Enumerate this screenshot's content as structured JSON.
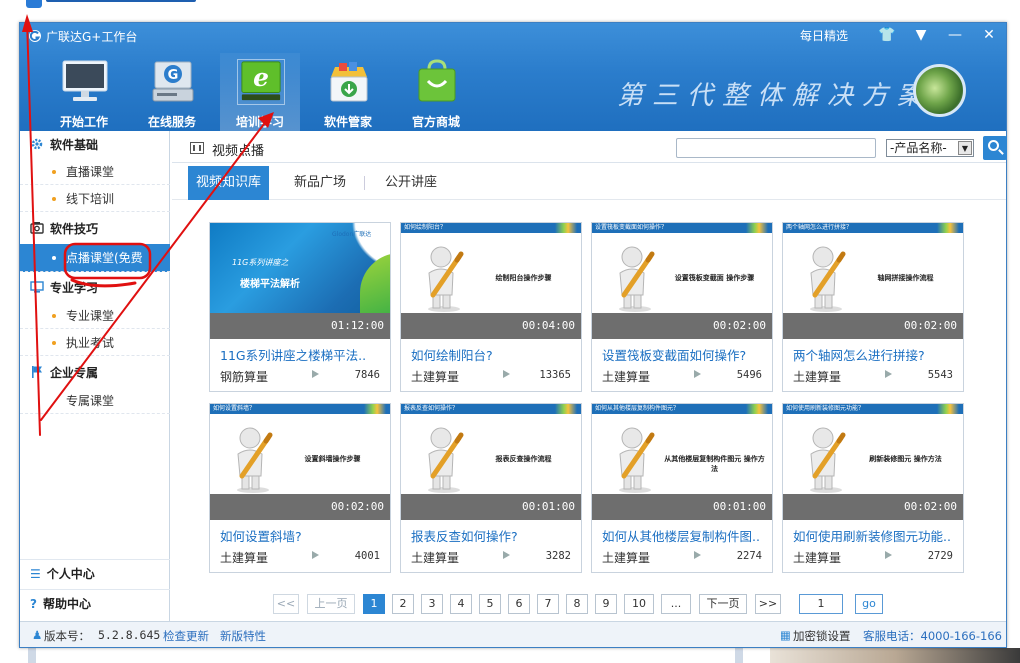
{
  "app": {
    "title": "广联达G+工作台"
  },
  "window_controls": {
    "daily": "每日精选",
    "shirt": "👕",
    "dropdown": "▼",
    "minimize": "—",
    "close": "✕"
  },
  "nav": [
    {
      "label": "开始工作",
      "icon": "monitor-icon"
    },
    {
      "label": "在线服务",
      "icon": "server-icon"
    },
    {
      "label": "培训学习",
      "icon": "ie-browser-icon"
    },
    {
      "label": "软件管家",
      "icon": "software-box-icon"
    },
    {
      "label": "官方商城",
      "icon": "shopping-bag-icon"
    }
  ],
  "slogan": "第三代整体解决方案",
  "sidebar": {
    "cat1": "软件基础",
    "items1": [
      "直播课堂",
      "线下培训"
    ],
    "cat2": "软件技巧",
    "items2": [
      "点播课堂(免费"
    ],
    "cat3": "专业学习",
    "items3": [
      "专业课堂",
      "执业考试"
    ],
    "cat4": "企业专属",
    "items4": [
      "专属课堂"
    ],
    "personal": "个人中心",
    "help": "帮助中心"
  },
  "header": {
    "title": "视频点播",
    "select_value": "-产品名称-"
  },
  "tabs": [
    "视频知识库",
    "新品广场",
    "公开讲座"
  ],
  "cards": [
    {
      "title": "11G系列讲座之楼梯平法..",
      "category": "钢筋算量",
      "views": "7846",
      "duration": "01:12:00",
      "thumb_top": "",
      "thumb_desc": "",
      "t1": "11G系列讲座之",
      "t2": "楼梯平法解析",
      "t3": "Glodon广联达"
    },
    {
      "title": "如何绘制阳台?",
      "category": "土建算量",
      "views": "13365",
      "duration": "00:04:00",
      "thumb_top": "如何绘制阳台？",
      "thumb_desc": "绘制阳台操作步骤"
    },
    {
      "title": "设置筏板变截面如何操作?",
      "category": "土建算量",
      "views": "5496",
      "duration": "00:02:00",
      "thumb_top": "设置筏板变截面如何操作？",
      "thumb_desc": "设置筏板变截面 操作步骤"
    },
    {
      "title": "两个轴网怎么进行拼接?",
      "category": "土建算量",
      "views": "5543",
      "duration": "00:02:00",
      "thumb_top": "两个轴网怎么进行拼接？",
      "thumb_desc": "轴网拼接操作流程"
    },
    {
      "title": "如何设置斜墙?",
      "category": "土建算量",
      "views": "4001",
      "duration": "00:02:00",
      "thumb_top": "如何设置斜墙？",
      "thumb_desc": "设置斜墙操作步骤"
    },
    {
      "title": "报表反查如何操作?",
      "category": "土建算量",
      "views": "3282",
      "duration": "00:01:00",
      "thumb_top": "报表反查如何操作？",
      "thumb_desc": "报表反查操作流程"
    },
    {
      "title": "如何从其他楼层复制构件图..",
      "category": "土建算量",
      "views": "2274",
      "duration": "00:01:00",
      "thumb_top": "如何从其他楼层复制构件图元？",
      "thumb_desc": "从其他楼层复制构件图元 操作方法"
    },
    {
      "title": "如何使用刷新装修图元功能..",
      "category": "土建算量",
      "views": "2729",
      "duration": "00:02:00",
      "thumb_top": "如何使用刷新装修图元功能？",
      "thumb_desc": "刷新装修图元 操作方法"
    }
  ],
  "pager": {
    "first": "<<",
    "prev": "上一页",
    "pages": [
      "1",
      "2",
      "3",
      "4",
      "5",
      "6",
      "7",
      "8",
      "9",
      "10"
    ],
    "ellipsis": "...",
    "next": "下一页",
    "last": ">>",
    "go_value": "1",
    "go": "go"
  },
  "status": {
    "version_label": "版本号：",
    "version": "5.2.8.645",
    "check_update": "检查更新",
    "new_features": "新版特性",
    "lock_settings": "加密锁设置",
    "hotline": "客服电话：4000-166-166"
  },
  "colors": {
    "accent": "#2c86d3",
    "annotation": "#e01010"
  }
}
